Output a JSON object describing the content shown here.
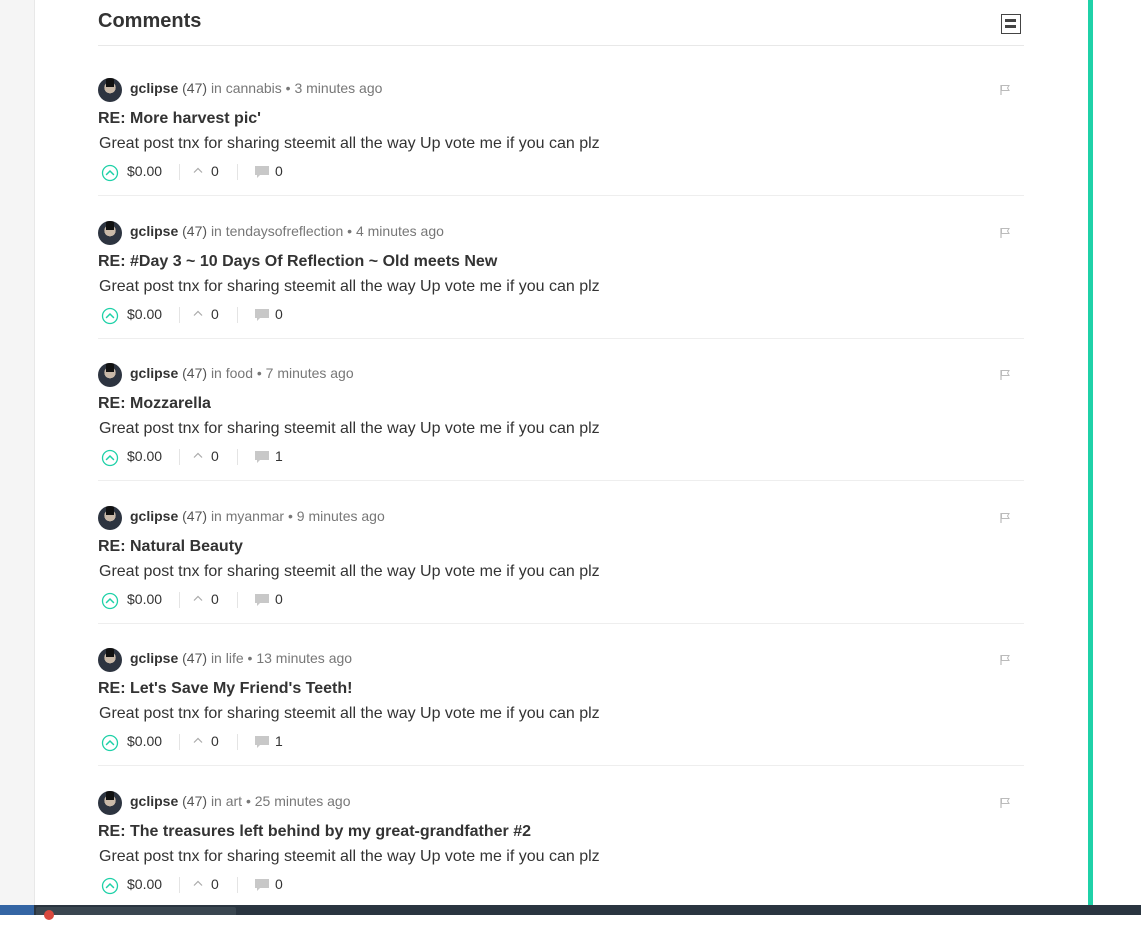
{
  "section": {
    "title": "Comments"
  },
  "comments": [
    {
      "author": "gclipse",
      "reputation": "(47)",
      "in_label": "in",
      "category": "cannabis",
      "time": "3 minutes ago",
      "title": "RE: More harvest pic'",
      "body": "Great post tnx for sharing steemit all the way Up vote me if you can plz",
      "payout": "$0.00",
      "votes": "0",
      "replies": "0"
    },
    {
      "author": "gclipse",
      "reputation": "(47)",
      "in_label": "in",
      "category": "tendaysofreflection",
      "time": "4 minutes ago",
      "title": "RE: #Day 3 ~ 10 Days Of Reflection ~ Old meets New",
      "body": "Great post tnx for sharing steemit all the way Up vote me if you can plz",
      "payout": "$0.00",
      "votes": "0",
      "replies": "0"
    },
    {
      "author": "gclipse",
      "reputation": "(47)",
      "in_label": "in",
      "category": "food",
      "time": "7 minutes ago",
      "title": "RE: Mozzarella",
      "body": "Great post tnx for sharing steemit all the way Up vote me if you can plz",
      "payout": "$0.00",
      "votes": "0",
      "replies": "1"
    },
    {
      "author": "gclipse",
      "reputation": "(47)",
      "in_label": "in",
      "category": "myanmar",
      "time": "9 minutes ago",
      "title": "RE: Natural Beauty",
      "body": "Great post tnx for sharing steemit all the way Up vote me if you can plz",
      "payout": "$0.00",
      "votes": "0",
      "replies": "0"
    },
    {
      "author": "gclipse",
      "reputation": "(47)",
      "in_label": "in",
      "category": "life",
      "time": "13 minutes ago",
      "title": "RE: Let's Save My Friend's Teeth!",
      "body": "Great post tnx for sharing steemit all the way Up vote me if you can plz",
      "payout": "$0.00",
      "votes": "0",
      "replies": "1"
    },
    {
      "author": "gclipse",
      "reputation": "(47)",
      "in_label": "in",
      "category": "art",
      "time": "25 minutes ago",
      "title": "RE: The treasures left behind by my great-grandfather #2",
      "body": "Great post tnx for sharing steemit all the way Up vote me if you can plz",
      "payout": "$0.00",
      "votes": "0",
      "replies": "0"
    }
  ],
  "colors": {
    "accent": "#1fd1a8",
    "text": "#333333",
    "muted": "#777777"
  },
  "icons": {
    "upvote": "upvote-circle-icon",
    "votes": "chevron-up-icon",
    "replies": "chat-bubble-icon",
    "flag": "flag-icon",
    "collapse": "collapse-icon"
  }
}
